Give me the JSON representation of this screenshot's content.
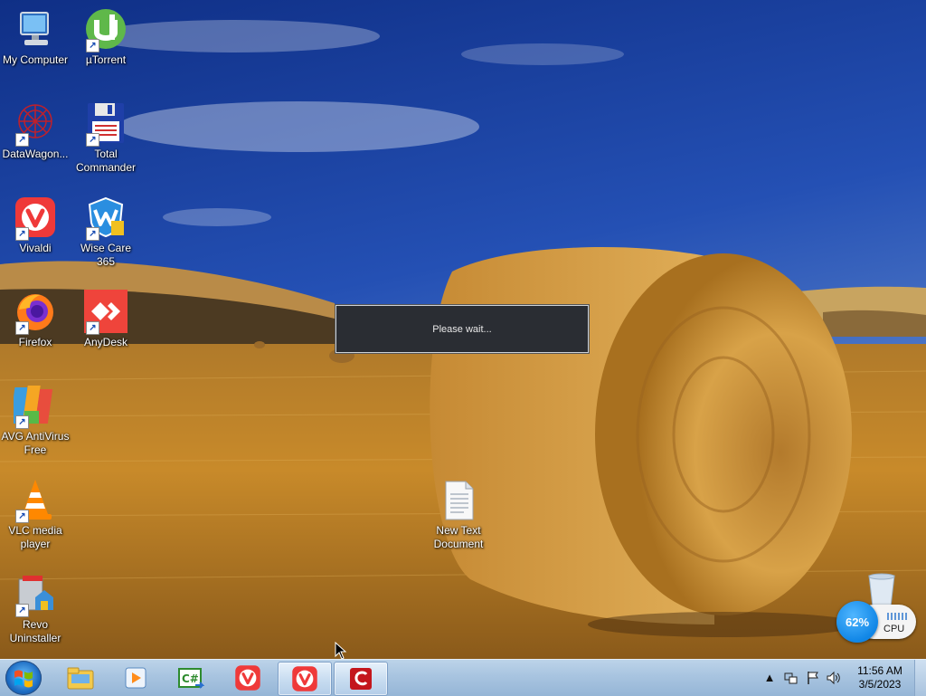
{
  "desktop": {
    "icons": [
      {
        "label": "My Computer"
      },
      {
        "label": "µTorrent"
      },
      {
        "label": "DataWagon..."
      },
      {
        "label": "Total Commander"
      },
      {
        "label": "Vivaldi"
      },
      {
        "label": "Wise Care 365"
      },
      {
        "label": "Firefox"
      },
      {
        "label": "AnyDesk"
      },
      {
        "label": "AVG AntiVirus Free"
      },
      {
        "label": "VLC media player"
      },
      {
        "label": "Revo Uninstaller"
      },
      {
        "label": "New Text Document"
      }
    ],
    "recycle_bin_icon": "recycle-bin-icon"
  },
  "dialog": {
    "message": "Please wait..."
  },
  "gadget": {
    "cpu_percent": "62%",
    "label": "CPU"
  },
  "taskbar": {
    "pinned": [
      {
        "icon": "file-explorer-icon"
      },
      {
        "icon": "media-player-icon"
      },
      {
        "icon": "csharp-icon"
      },
      {
        "icon": "vivaldi-icon"
      },
      {
        "icon": "vivaldi-icon",
        "active": true
      },
      {
        "icon": "ccleaner-icon",
        "active": true
      }
    ],
    "clock": {
      "time": "11:56 AM",
      "date": "3/5/2023"
    }
  },
  "colors": {
    "sky": "#1d3f9a",
    "field": "#c88a2a",
    "dialog_bg": "#2a2d33",
    "taskbar": "#a8c4e0",
    "gadget_blue": "#1086e6"
  }
}
